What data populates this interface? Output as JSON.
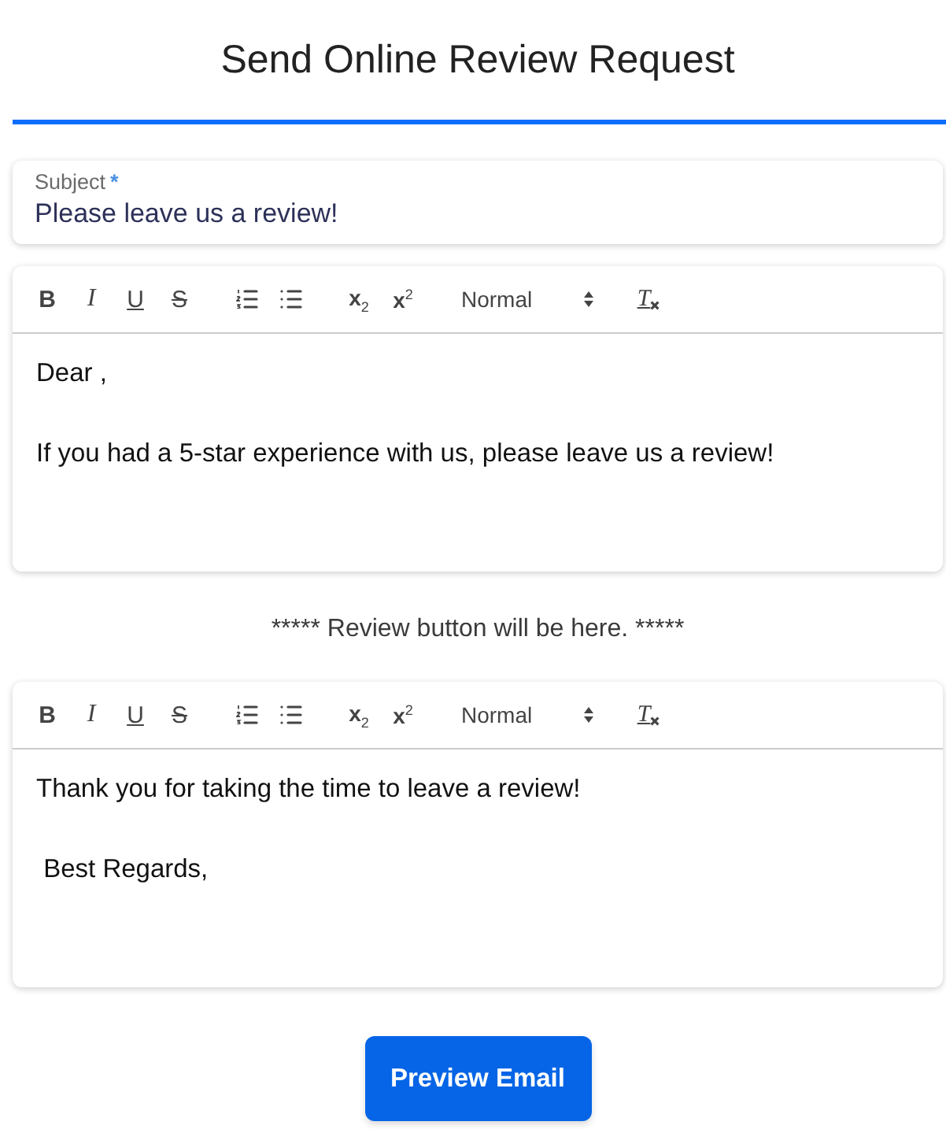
{
  "title": "Send Online Review Request",
  "subject": {
    "label": "Subject",
    "required_mark": "*",
    "value": "Please leave us a review!"
  },
  "sections": [
    {
      "kind": "editor",
      "toolbar_groups": [
        {
          "buttons": [
            {
              "kind": "bold",
              "label": "B"
            },
            {
              "kind": "italic",
              "label": "I"
            },
            {
              "kind": "underline",
              "label": "U"
            },
            {
              "kind": "strike",
              "label": "S"
            }
          ]
        },
        {
          "buttons": [
            {
              "kind": "ordered-list"
            },
            {
              "kind": "bullet-list"
            }
          ]
        },
        {
          "buttons": [
            {
              "kind": "script",
              "label": "x$_{2}$"
            },
            {
              "kind": "script",
              "label": "x$^{2}$"
            }
          ]
        },
        {
          "buttons": [
            {
              "kind": "header",
              "label": "Normal"
            }
          ]
        },
        {
          "buttons": [
            {
              "kind": "clean",
              "label": "T"
            }
          ]
        }
      ],
      "paragraphs": [
        "Dear ,",
        "If you had a 5-star experience with us, please leave us a review!"
      ]
    },
    {
      "kind": "note",
      "text": "***** Review button will be here. *****"
    },
    {
      "kind": "editor",
      "toolbar_groups": [
        {
          "buttons": [
            {
              "kind": "bold",
              "label": "B"
            },
            {
              "kind": "italic",
              "label": "I"
            },
            {
              "kind": "underline",
              "label": "U"
            },
            {
              "kind": "strike",
              "label": "S"
            }
          ]
        },
        {
          "buttons": [
            {
              "kind": "ordered-list"
            },
            {
              "kind": "bullet-list"
            }
          ]
        },
        {
          "buttons": [
            {
              "kind": "script",
              "label": "x$_{2}$"
            },
            {
              "kind": "script",
              "label": "x$^{2}$"
            }
          ]
        },
        {
          "buttons": [
            {
              "kind": "header",
              "label": "Normal"
            }
          ]
        },
        {
          "buttons": [
            {
              "kind": "clean",
              "label": "T"
            }
          ]
        }
      ],
      "paragraphs": [
        "Thank you for taking the time to leave a review!",
        " Best Regards,"
      ]
    }
  ],
  "preview_button": "Preview Email"
}
